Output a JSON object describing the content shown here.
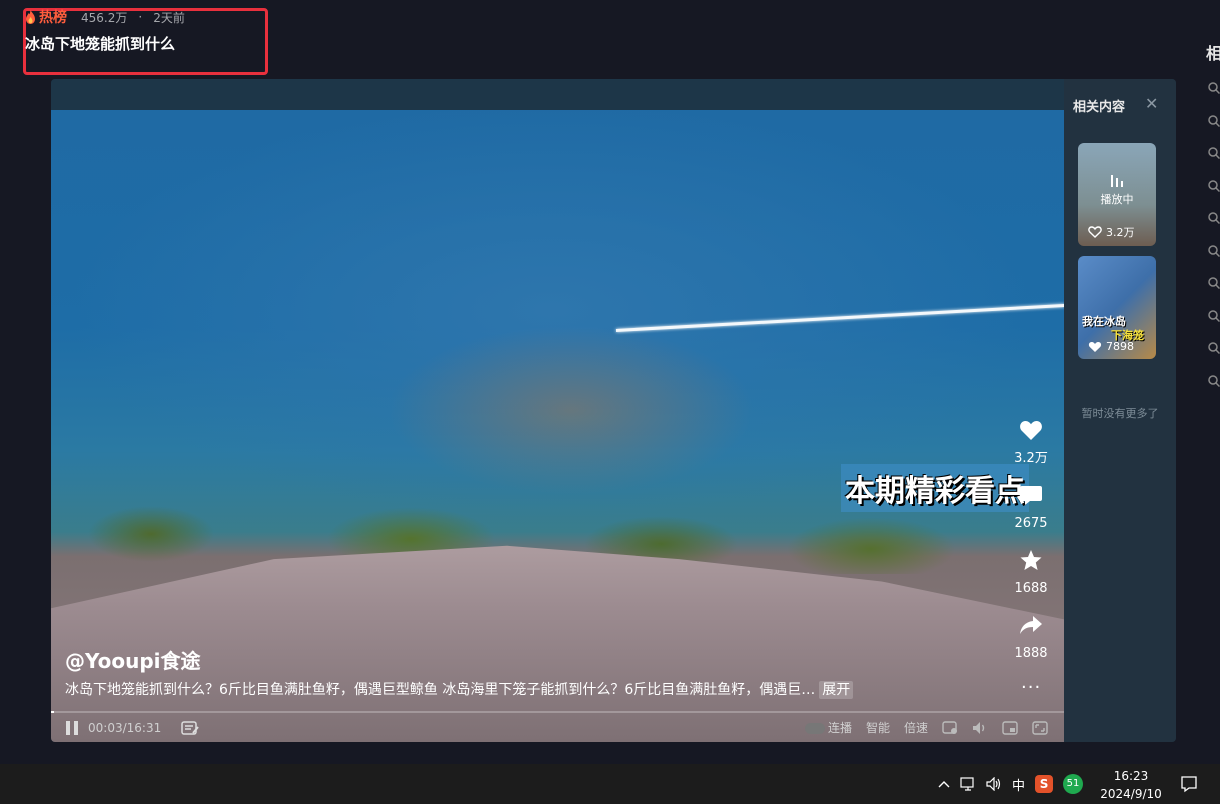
{
  "header": {
    "hot_label": "热榜",
    "views": "456.2万",
    "dot": "·",
    "time_ago": "2天前",
    "title": "冰岛下地笼能抓到什么"
  },
  "right_column": {
    "heading_fragment": "相"
  },
  "video": {
    "overlay_caption": "本期精彩看点",
    "author": "@Yooupi食途",
    "description": "冰岛下地笼能抓到什么？6斤比目鱼满肚鱼籽，偶遇巨型鲸鱼 冰岛海里下笼子能抓到什么？6斤比目鱼满肚鱼籽，偶遇巨…",
    "expand_label": "展开",
    "more_label": "···",
    "actions": {
      "likes": "3.2万",
      "comments": "2675",
      "favorites": "1688",
      "shares": "1888"
    },
    "progress_fraction": 0.003,
    "controls": {
      "time": "00:03/16:31",
      "autoplay_label": "连播",
      "smart_label": "智能",
      "speed_label": "倍速"
    }
  },
  "side_panel": {
    "title": "相关内容",
    "close": "✕",
    "items": [
      {
        "status": "播放中",
        "likes": "3.2万"
      },
      {
        "tag_line1": "我在冰岛",
        "tag_line2": "下海笼",
        "likes": "7898"
      }
    ],
    "no_more": "暂时没有更多了"
  },
  "taskbar": {
    "ime": "中",
    "sogou": "S",
    "badge": "51",
    "time": "16:23",
    "date": "2024/9/10"
  }
}
